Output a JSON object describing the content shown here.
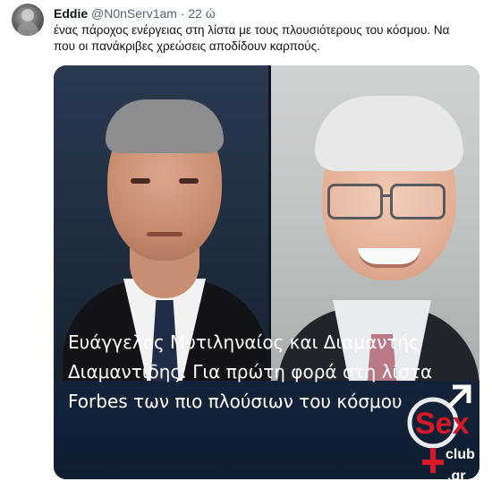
{
  "tweet": {
    "display_name": "Eddie",
    "handle": "@N0nServ1am",
    "separator": "·",
    "time": "22 ώ",
    "text": "ένας πάροχος ενέργειας στη λίστα με τους πλουσιότερους του κόσμου. Να που οι πανάκριβες χρεώσεις αποδίδουν καρπούς."
  },
  "media": {
    "caption_lines": [
      "Ευάγγελος Μυτιληναίος και Διαμαντής",
      "Διαμαντίδης: Για πρώτη φορά στη λίστα",
      "Forbes των πιο πλούσιων του κόσμου"
    ],
    "watermark": {
      "word": "Sex",
      "sub": "club",
      "domain": ".gr"
    }
  },
  "colors": {
    "text_primary": "#0f1419",
    "text_secondary": "#536471",
    "caption_bg": "#13243a",
    "watermark_red": "#d6182a"
  }
}
